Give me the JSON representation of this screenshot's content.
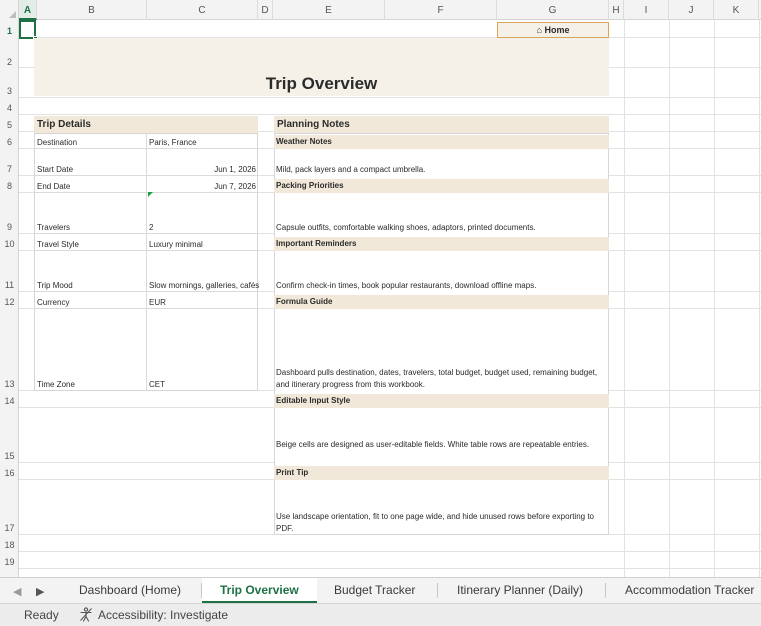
{
  "spreadsheet": {
    "columns": [
      "A",
      "B",
      "C",
      "D",
      "E",
      "F",
      "G",
      "H",
      "I",
      "J",
      "K"
    ],
    "rows": [
      "1",
      "2",
      "3",
      "4",
      "5",
      "6",
      "7",
      "8",
      "9",
      "10",
      "11",
      "12",
      "13",
      "14",
      "15",
      "16",
      "17",
      "18",
      "19"
    ],
    "selected_cell": "A1"
  },
  "sheet": {
    "home_button": "⌂ Home",
    "title": "Trip Overview",
    "trip_details": {
      "heading": "Trip Details",
      "rows": [
        {
          "label": "Destination",
          "value": "Paris, France"
        },
        {
          "label": "Start Date",
          "value": "Jun 1, 2026"
        },
        {
          "label": "End Date",
          "value": "Jun 7, 2026"
        },
        {
          "label": "Travelers",
          "value": "2"
        },
        {
          "label": "Travel Style",
          "value": "Luxury minimal"
        },
        {
          "label": "Trip Mood",
          "value": "Slow mornings, galleries, cafés"
        },
        {
          "label": "Currency",
          "value": "EUR"
        },
        {
          "label": "Time Zone",
          "value": "CET"
        }
      ]
    },
    "planning_notes": {
      "heading": "Planning Notes",
      "items": [
        {
          "title": "Weather Notes",
          "body": "Mild, pack layers and a compact umbrella."
        },
        {
          "title": "Packing Priorities",
          "body": "Capsule outfits, comfortable walking shoes, adaptors, printed documents."
        },
        {
          "title": "Important Reminders",
          "body": "Confirm check-in times, book popular restaurants, download offline maps."
        },
        {
          "title": "Formula Guide",
          "body": "Dashboard pulls destination, dates, travelers, total budget, budget used, remaining budget, and itinerary progress from this workbook."
        },
        {
          "title": "Editable Input Style",
          "body": "Beige cells are designed as user-editable fields. White table rows are repeatable entries."
        },
        {
          "title": "Print Tip",
          "body": "Use landscape orientation, fit to one page wide, and hide unused rows before exporting to PDF."
        }
      ]
    }
  },
  "tabs": {
    "items": [
      "Dashboard (Home)",
      "Trip Overview",
      "Budget Tracker",
      "Itinerary Planner (Daily)",
      "Accommodation Tracker"
    ],
    "active": "Trip Overview",
    "prev_icon": "◀",
    "next_icon": "▶"
  },
  "status": {
    "ready": "Ready",
    "accessibility": "Accessibility: Investigate"
  },
  "colors": {
    "accent": "#1e7145",
    "beige": "#f6f1e8",
    "section_beige": "#f1e8d9",
    "home_border": "#d9a55a"
  }
}
